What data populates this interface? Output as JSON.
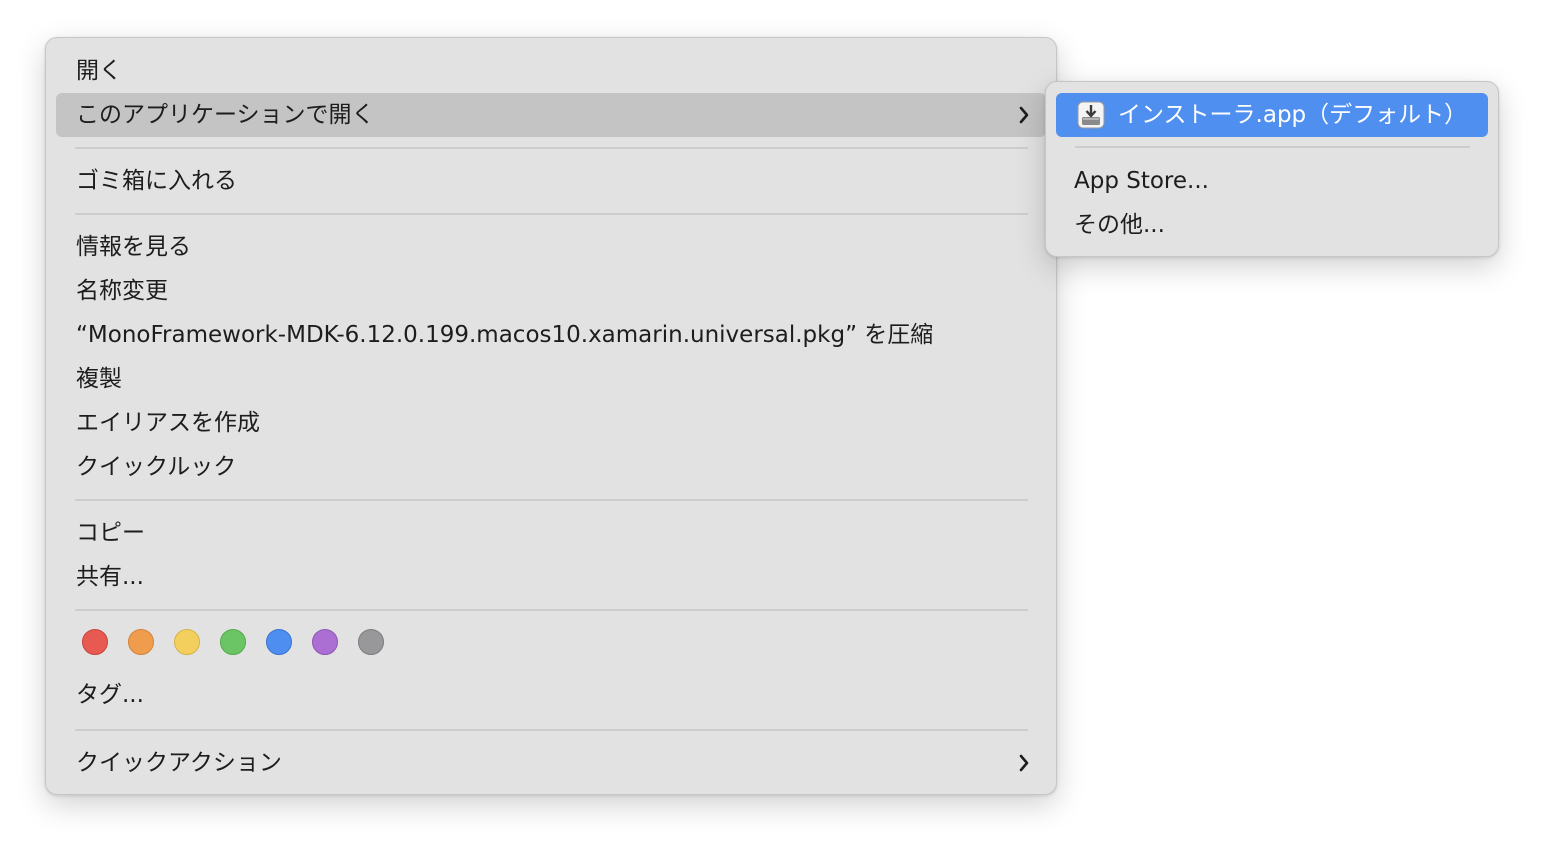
{
  "context_menu": {
    "items": {
      "open": "開く",
      "open_with": "このアプリケーションで開く",
      "move_to_trash": "ゴミ箱に入れる",
      "get_info": "情報を見る",
      "rename": "名称変更",
      "compress": "“MonoFramework-MDK-6.12.0.199.macos10.xamarin.universal.pkg” を圧縮",
      "duplicate": "複製",
      "make_alias": "エイリアスを作成",
      "quick_look": "クイックルック",
      "copy": "コピー",
      "share": "共有...",
      "tags": "タグ...",
      "quick_actions": "クイックアクション"
    },
    "tag_colors": [
      "#e65a52",
      "#ef9c4d",
      "#f3cf5d",
      "#6bc564",
      "#4d8ef0",
      "#ab6fd4",
      "#98989a"
    ],
    "tag_color_borders": [
      "#c8433c",
      "#d3823a",
      "#d7b349",
      "#54a84e",
      "#3b72cf",
      "#8d56b4",
      "#7c7c7e"
    ]
  },
  "submenu": {
    "default_app": "インストーラ.app（デフォルト）",
    "app_store": "App Store...",
    "other": "その他..."
  },
  "icons": {
    "chevron": "chevron-right-icon",
    "installer": "installer-icon"
  }
}
